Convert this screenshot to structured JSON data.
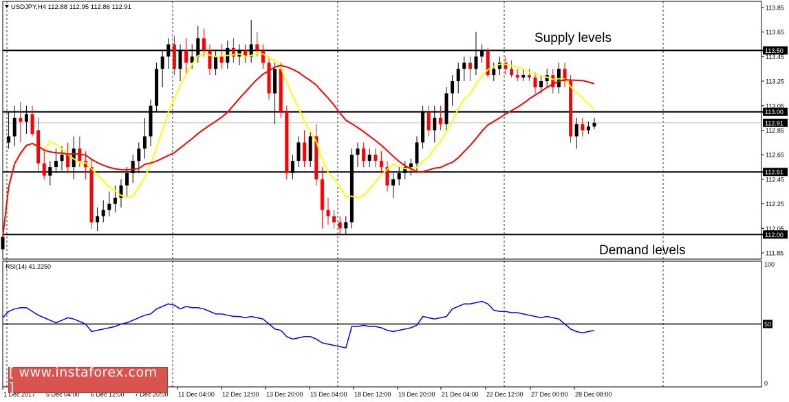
{
  "header": {
    "menu_icon": "triangle-down-icon",
    "text": "USDJPY,H4  112.88 112.95 112.86 112.91"
  },
  "annotations": {
    "supply": "Supply levels",
    "demand": "Demand levels"
  },
  "rsi_label": "RSI(14) 41.2250",
  "watermark": "[ www.instaforex.com ]",
  "colors": {
    "bull": "#000000",
    "bear": "#ff0000",
    "ma_fast": "#ffff00",
    "ma_slow": "#ff0000",
    "rsi": "#0000ff",
    "grid": "#000000"
  },
  "chart_data": [
    {
      "type": "candlestick",
      "symbol": "USDJPY",
      "timeframe": "H4",
      "ylim": [
        111.8,
        113.9
      ],
      "y_ticks": [
        "113.85",
        "113.65",
        "113.45",
        "113.25",
        "113.05",
        "112.85",
        "112.65",
        "112.45",
        "112.25",
        "112.05",
        "111.85"
      ],
      "level_lines": [
        "113.50",
        "113.00",
        "112.51",
        "112.00"
      ],
      "current_price": "112.91",
      "x_tick_labels": [
        "1 Dec 2017",
        "5 Dec 04:00",
        "6 Dec 12:00",
        "7 Dec 20:00",
        "11 Dec 04:00",
        "12 Dec 12:00",
        "13 Dec 20:00",
        "15 Dec 04:00",
        "18 Dec 12:00",
        "19 Dec 20:00",
        "21 Dec 04:00",
        "22 Dec 12:00",
        "27 Dec 00:00",
        "28 Dec 08:00"
      ],
      "ohlc": [
        [
          111.88,
          112.0,
          111.85,
          111.98
        ],
        [
          112.75,
          113.0,
          112.7,
          112.8
        ],
        [
          112.8,
          113.05,
          112.72,
          112.95
        ],
        [
          112.95,
          113.08,
          112.75,
          112.92
        ],
        [
          112.92,
          113.05,
          112.82,
          112.98
        ],
        [
          112.98,
          113.05,
          112.8,
          112.82
        ],
        [
          112.85,
          112.95,
          112.52,
          112.58
        ],
        [
          112.58,
          112.7,
          112.45,
          112.48
        ],
        [
          112.48,
          112.6,
          112.4,
          112.55
        ],
        [
          112.55,
          112.7,
          112.5,
          112.6
        ],
        [
          112.6,
          112.72,
          112.52,
          112.65
        ],
        [
          112.65,
          112.75,
          112.5,
          112.55
        ],
        [
          112.55,
          112.8,
          112.45,
          112.7
        ],
        [
          112.7,
          112.8,
          112.55,
          112.6
        ],
        [
          112.6,
          112.68,
          112.45,
          112.55
        ],
        [
          112.55,
          112.62,
          112.05,
          112.1
        ],
        [
          112.1,
          112.22,
          112.03,
          112.15
        ],
        [
          112.15,
          112.28,
          112.1,
          112.2
        ],
        [
          112.2,
          112.35,
          112.15,
          112.25
        ],
        [
          112.25,
          112.4,
          112.18,
          112.3
        ],
        [
          112.3,
          112.45,
          112.22,
          112.4
        ],
        [
          112.4,
          112.55,
          112.3,
          112.5
        ],
        [
          112.5,
          112.65,
          112.42,
          112.6
        ],
        [
          112.6,
          112.75,
          112.5,
          112.7
        ],
        [
          112.7,
          112.95,
          112.62,
          112.8
        ],
        [
          112.8,
          113.1,
          112.72,
          113.05
        ],
        [
          113.05,
          113.4,
          113.0,
          113.35
        ],
        [
          113.35,
          113.5,
          113.2,
          113.45
        ],
        [
          113.45,
          113.6,
          113.35,
          113.55
        ],
        [
          113.55,
          113.62,
          113.3,
          113.35
        ],
        [
          113.35,
          113.55,
          113.25,
          113.5
        ],
        [
          113.5,
          113.6,
          113.3,
          113.4
        ],
        [
          113.4,
          113.55,
          113.35,
          113.45
        ],
        [
          113.45,
          113.7,
          113.4,
          113.6
        ],
        [
          113.6,
          113.68,
          113.45,
          113.5
        ],
        [
          113.5,
          113.55,
          113.3,
          113.35
        ],
        [
          113.35,
          113.5,
          113.3,
          113.45
        ],
        [
          113.45,
          113.55,
          113.35,
          113.4
        ],
        [
          113.4,
          113.58,
          113.35,
          113.52
        ],
        [
          113.52,
          113.6,
          113.4,
          113.45
        ],
        [
          113.45,
          113.55,
          113.38,
          113.5
        ],
        [
          113.5,
          113.55,
          113.4,
          113.45
        ],
        [
          113.45,
          113.75,
          113.4,
          113.55
        ],
        [
          113.55,
          113.65,
          113.45,
          113.5
        ],
        [
          113.5,
          113.55,
          113.35,
          113.4
        ],
        [
          113.4,
          113.45,
          113.1,
          113.15
        ],
        [
          113.15,
          113.4,
          112.9,
          113.35
        ],
        [
          113.35,
          113.4,
          112.95,
          113.0
        ],
        [
          113.0,
          113.05,
          112.45,
          112.5
        ],
        [
          112.5,
          112.65,
          112.45,
          112.6
        ],
        [
          112.6,
          112.8,
          112.55,
          112.75
        ],
        [
          112.75,
          112.85,
          112.55,
          112.6
        ],
        [
          112.6,
          112.85,
          112.55,
          112.8
        ],
        [
          112.8,
          112.9,
          112.4,
          112.45
        ],
        [
          112.45,
          112.55,
          112.05,
          112.2
        ],
        [
          112.2,
          112.3,
          112.08,
          112.15
        ],
        [
          112.15,
          112.2,
          112.05,
          112.1
        ],
        [
          112.1,
          112.15,
          112.0,
          112.05
        ],
        [
          112.05,
          112.15,
          112.0,
          112.1
        ],
        [
          112.1,
          112.7,
          112.05,
          112.65
        ],
        [
          112.65,
          112.75,
          112.55,
          112.7
        ],
        [
          112.7,
          112.75,
          112.55,
          112.6
        ],
        [
          112.6,
          112.7,
          112.55,
          112.65
        ],
        [
          112.65,
          112.7,
          112.55,
          112.6
        ],
        [
          112.6,
          112.68,
          112.5,
          112.55
        ],
        [
          112.55,
          112.6,
          112.35,
          112.4
        ],
        [
          112.4,
          112.5,
          112.3,
          112.45
        ],
        [
          112.45,
          112.55,
          112.4,
          112.5
        ],
        [
          112.5,
          112.6,
          112.45,
          112.55
        ],
        [
          112.55,
          112.62,
          112.48,
          112.58
        ],
        [
          112.58,
          112.8,
          112.5,
          112.75
        ],
        [
          112.75,
          113.05,
          112.7,
          113.0
        ],
        [
          113.0,
          113.05,
          112.8,
          112.85
        ],
        [
          112.85,
          113.05,
          112.75,
          112.95
        ],
        [
          112.95,
          113.05,
          112.85,
          112.9
        ],
        [
          112.9,
          113.2,
          112.85,
          113.15
        ],
        [
          113.15,
          113.3,
          113.05,
          113.25
        ],
        [
          113.25,
          113.4,
          113.15,
          113.35
        ],
        [
          113.35,
          113.45,
          113.25,
          113.4
        ],
        [
          113.4,
          113.45,
          113.25,
          113.35
        ],
        [
          113.35,
          113.65,
          113.3,
          113.45
        ],
        [
          113.45,
          113.55,
          113.4,
          113.5
        ],
        [
          113.5,
          113.52,
          113.28,
          113.3
        ],
        [
          113.3,
          113.4,
          113.25,
          113.35
        ],
        [
          113.35,
          113.45,
          113.3,
          113.4
        ],
        [
          113.4,
          113.45,
          113.3,
          113.35
        ],
        [
          113.35,
          113.42,
          113.28,
          113.3
        ],
        [
          113.3,
          113.35,
          113.25,
          113.28
        ],
        [
          113.28,
          113.35,
          113.25,
          113.3
        ],
        [
          113.3,
          113.35,
          113.25,
          113.28
        ],
        [
          113.28,
          113.32,
          113.15,
          113.2
        ],
        [
          113.2,
          113.3,
          113.15,
          113.25
        ],
        [
          113.25,
          113.35,
          113.2,
          113.3
        ],
        [
          113.3,
          113.35,
          113.15,
          113.2
        ],
        [
          113.2,
          113.4,
          113.15,
          113.35
        ],
        [
          113.35,
          113.4,
          113.2,
          113.25
        ],
        [
          113.25,
          113.3,
          112.75,
          112.8
        ],
        [
          112.8,
          112.95,
          112.7,
          112.9
        ],
        [
          112.9,
          112.95,
          112.8,
          112.85
        ],
        [
          112.85,
          112.92,
          112.82,
          112.88
        ],
        [
          112.88,
          112.95,
          112.86,
          112.91
        ]
      ],
      "overlays": [
        {
          "indicator": "moving-average-fast",
          "color": "#ffff00"
        },
        {
          "indicator": "moving-average-slow",
          "color": "#ff0000"
        }
      ]
    },
    {
      "type": "line",
      "name": "RSI(14) 41.2250",
      "ylim": [
        0,
        100
      ],
      "y_ticks": [
        "100",
        "50",
        "0"
      ],
      "level_line": 50,
      "values": [
        55,
        60,
        62,
        63,
        63,
        60,
        57,
        55,
        53,
        51,
        53,
        55,
        54,
        52,
        50,
        44,
        45,
        46,
        47,
        48,
        50,
        51,
        53,
        55,
        57,
        58,
        62,
        64,
        66,
        65,
        62,
        64,
        63,
        63,
        62,
        60,
        58,
        58,
        57,
        56,
        56,
        55,
        56,
        55,
        54,
        50,
        46,
        45,
        40,
        38,
        39,
        40,
        40,
        38,
        35,
        34,
        33,
        32,
        31,
        48,
        48,
        49,
        48,
        48,
        47,
        45,
        44,
        45,
        46,
        47,
        49,
        56,
        55,
        54,
        55,
        56,
        62,
        64,
        66,
        66,
        67,
        68,
        66,
        61,
        60,
        60,
        59,
        59,
        58,
        57,
        56,
        55,
        56,
        55,
        54,
        50,
        46,
        44,
        43,
        44,
        45
      ]
    }
  ]
}
